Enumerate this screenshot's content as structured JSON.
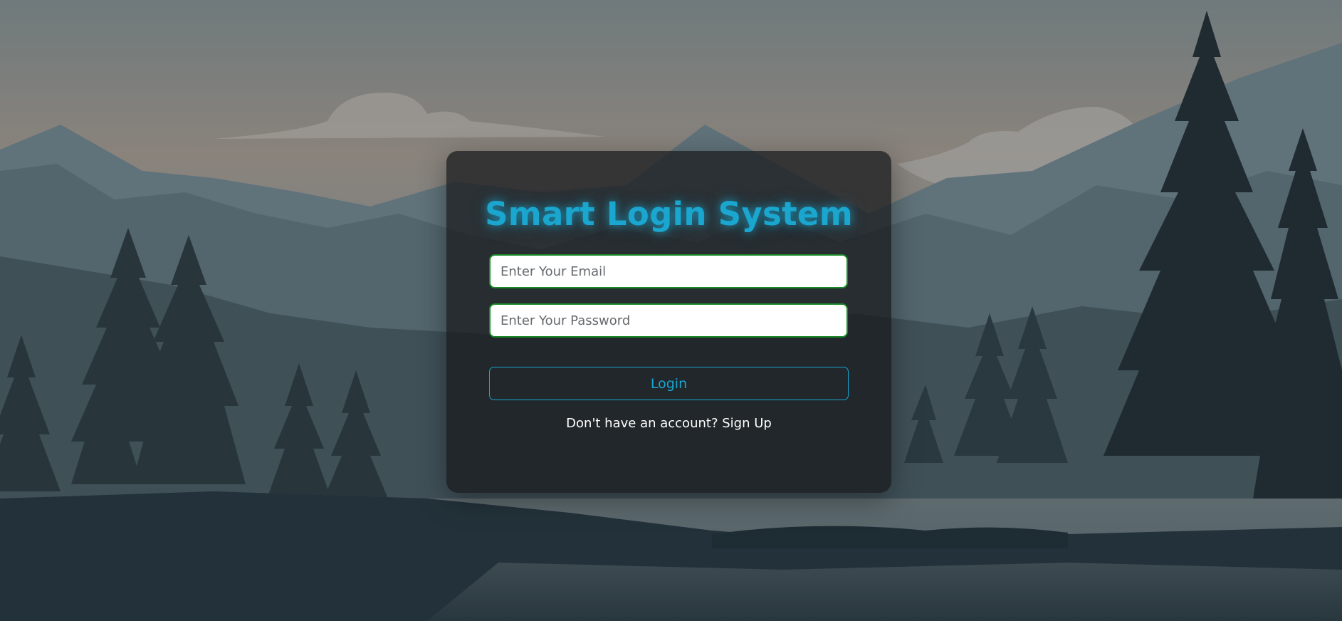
{
  "login_card": {
    "title": "Smart Login System",
    "email_placeholder": "Enter Your Email",
    "password_placeholder": "Enter Your Password",
    "login_label": "Login",
    "signup_prompt": "Don't have an account?",
    "signup_link": "Sign Up"
  },
  "colors": {
    "accent": "#1aa6cf",
    "input_border": "#1b8a2a",
    "card_background": "rgba(22, 24, 26, 0.72)"
  },
  "icons": {
    "background": "mountain-forest-landscape"
  }
}
